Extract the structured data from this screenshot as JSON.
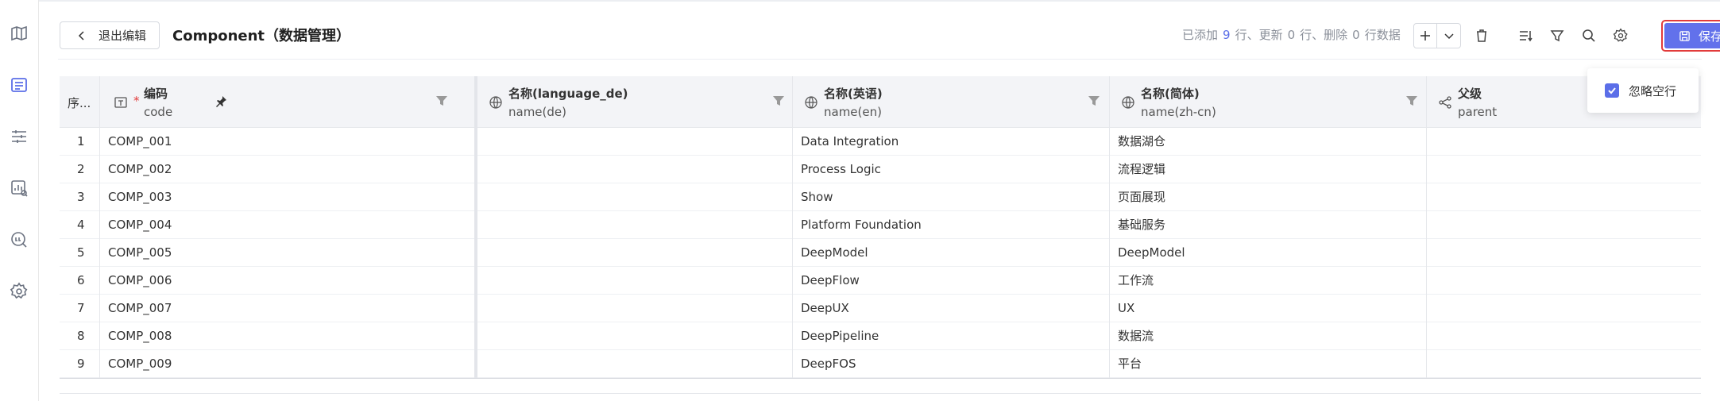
{
  "sidebar": {
    "items": [
      {
        "icon": "map-icon"
      },
      {
        "icon": "table-icon",
        "active": true
      },
      {
        "icon": "sliders-icon"
      },
      {
        "icon": "chart-search-icon"
      },
      {
        "icon": "query-icon"
      },
      {
        "icon": "gear-icon"
      }
    ],
    "active_color": "#5b6ee8"
  },
  "header": {
    "exit_label": "退出编辑",
    "title": "Component（数据管理）",
    "stats": {
      "added_prefix": "已添加",
      "added_count": "9",
      "added_suffix": "行、更新",
      "updated_count": "0",
      "updated_suffix": "行、删除",
      "deleted_count": "0",
      "deleted_suffix": "行数据"
    },
    "save_label": "保存",
    "save_color": "#6271eb",
    "highlight_color": "#e23b3b"
  },
  "popover": {
    "ignore_empty_label": "忽略空行",
    "checked": true
  },
  "table": {
    "seq_header": "序...",
    "columns": [
      {
        "title": "编码",
        "field": "code",
        "required": true,
        "pinned": true
      },
      {
        "title": "名称(language_de)",
        "field": "name(de)"
      },
      {
        "title": "名称(英语)",
        "field": "name(en)"
      },
      {
        "title": "名称(简体)",
        "field": "name(zh-cn)"
      },
      {
        "title": "父级",
        "field": "parent"
      }
    ],
    "rows": [
      {
        "seq": "1",
        "code": "COMP_001",
        "de": "",
        "en": "Data Integration",
        "zh": "数据湖仓",
        "parent": ""
      },
      {
        "seq": "2",
        "code": "COMP_002",
        "de": "",
        "en": "Process Logic",
        "zh": "流程逻辑",
        "parent": ""
      },
      {
        "seq": "3",
        "code": "COMP_003",
        "de": "",
        "en": "Show",
        "zh": "页面展现",
        "parent": ""
      },
      {
        "seq": "4",
        "code": "COMP_004",
        "de": "",
        "en": "Platform Foundation",
        "zh": "基础服务",
        "parent": ""
      },
      {
        "seq": "5",
        "code": "COMP_005",
        "de": "",
        "en": "DeepModel",
        "zh": "DeepModel",
        "parent": ""
      },
      {
        "seq": "6",
        "code": "COMP_006",
        "de": "",
        "en": "DeepFlow",
        "zh": "工作流",
        "parent": ""
      },
      {
        "seq": "7",
        "code": "COMP_007",
        "de": "",
        "en": "DeepUX",
        "zh": "UX",
        "parent": ""
      },
      {
        "seq": "8",
        "code": "COMP_008",
        "de": "",
        "en": "DeepPipeline",
        "zh": "数据流",
        "parent": ""
      },
      {
        "seq": "9",
        "code": "COMP_009",
        "de": "",
        "en": "DeepFOS",
        "zh": "平台",
        "parent": ""
      }
    ]
  }
}
